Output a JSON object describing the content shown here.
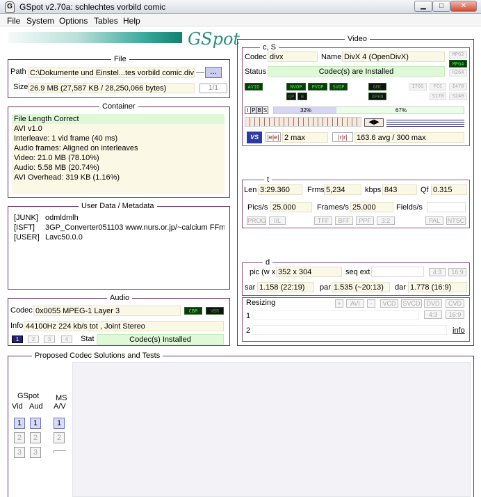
{
  "window": {
    "title": "GSpot v2.70a: schlechtes vorbild comic",
    "icon": "gspot-app-icon",
    "minimize_glyph": "▁",
    "maximize_glyph": "□",
    "close_glyph": "✕"
  },
  "menu": [
    "File",
    "System",
    "Options",
    "Tables",
    "Help"
  ],
  "logo": "GSpot",
  "file": {
    "title": "File",
    "path_label": "Path",
    "path_value": "C:\\Dokumente und Einstel...tes vorbild comic.divx",
    "browse_label": "...",
    "size_label": "Size",
    "size_value": "26.9 MB (27,587 KB / 28,250,066 bytes)",
    "page_indicator": "1/1"
  },
  "container": {
    "title": "Container",
    "lines": [
      "File Length Correct",
      "AVI v1.0",
      "Interleave: 1 vid frame (40 ms)",
      "Audio frames: Aligned on interleaves",
      "Video: 21.0 MB (78.10%)",
      "Audio: 5.58 MB (20.74%)",
      "AVI Overhead: 319 KB (1.16%)"
    ]
  },
  "userdata": {
    "title": "User Data / Metadata",
    "rows": [
      {
        "key": "[JUNK]",
        "val": "odmldmlh"
      },
      {
        "key": "[ISFT]",
        "val": "3GP_Converter051103 www.nurs.or.jp/~calcium FFm"
      },
      {
        "key": "[USER]",
        "val": "Lavc50.0.0"
      }
    ]
  },
  "audio": {
    "title": "Audio",
    "codec_label": "Codec",
    "codec_value": "0x0055 MPEG-1 Layer 3",
    "cbr": "CBR",
    "vbr": "VBR",
    "info_label": "Info",
    "info_value": "44100Hz  224 kb/s tot , Joint Stereo",
    "streams": [
      "1",
      "2",
      "3",
      "4"
    ],
    "stat_label": "Stat",
    "stat_value": "Codec(s) Installed"
  },
  "video": {
    "title": "Video",
    "cs_title": "c, S",
    "codec_label": "Codec",
    "codec_value": "divx",
    "name_label": "Name",
    "name_value": "DivX 4 (OpenDivX)",
    "status_label": "Status",
    "status_value": "Codec(s) are Installed",
    "fmt_badges": [
      "MPG2",
      "MPG4",
      "H264"
    ],
    "flags_row": [
      "AVID",
      "NVOP",
      "PVOP",
      "SVOP",
      "GMC",
      "I70S",
      "FCC",
      "I470"
    ],
    "flags_row2": [
      "QP",
      "B",
      "OPEN",
      "S170",
      "S240"
    ],
    "frame_types": [
      "I",
      "P",
      "B",
      "S"
    ],
    "pct_a": "32%",
    "pct_b": "67%",
    "bframes_label": "2 max",
    "bitrate_label": "163.6 avg / 300 max"
  },
  "timing": {
    "title": "t",
    "len_label": "Len",
    "len_value": "3:29.360",
    "frms_label": "Frms",
    "frms_value": "5,234",
    "kbps_label": "kbps",
    "kbps_value": "843",
    "qf_label": "Qf",
    "qf_value": "0.315",
    "pics_label": "Pics/s",
    "pics_value": "25.000",
    "frames_label": "Frames/s",
    "frames_value": "25.000",
    "fields_label": "Fields/s",
    "fields_value": "",
    "mode_buttons": [
      "PROG",
      "I/L",
      "TFF",
      "BFF",
      "PPF",
      "3:2",
      "PAL",
      "NTSC"
    ]
  },
  "dims": {
    "title": "d",
    "pic_label": "pic (w x",
    "pic_value": "352 x 304",
    "seq_label": "seq ext",
    "seq_value": "",
    "ar_a": "4:3",
    "ar_b": "16:9",
    "sar_label": "sar",
    "sar_value": "1.158 (22:19)",
    "par_label": "par",
    "par_value": "1.535 (~20:13)",
    "dar_label": "dar",
    "dar_value": "1.778 (16:9)"
  },
  "resizing": {
    "label": "Resizing",
    "buttons": [
      "+",
      "AVI",
      "-",
      "VCD",
      "SVCD",
      "DVD",
      "CVD"
    ],
    "row1": "1",
    "row2": "2",
    "ar_a": "4:3",
    "ar_b": "16:9",
    "info_link": "info"
  },
  "proposed": {
    "title": "Proposed Codec Solutions and Tests",
    "gspot_label": "GSpot",
    "vid_label": "Vid",
    "aud_label": "Aud",
    "ms_label": "MS",
    "av_label": "A/V",
    "nums": [
      "1",
      "2",
      "3"
    ]
  }
}
